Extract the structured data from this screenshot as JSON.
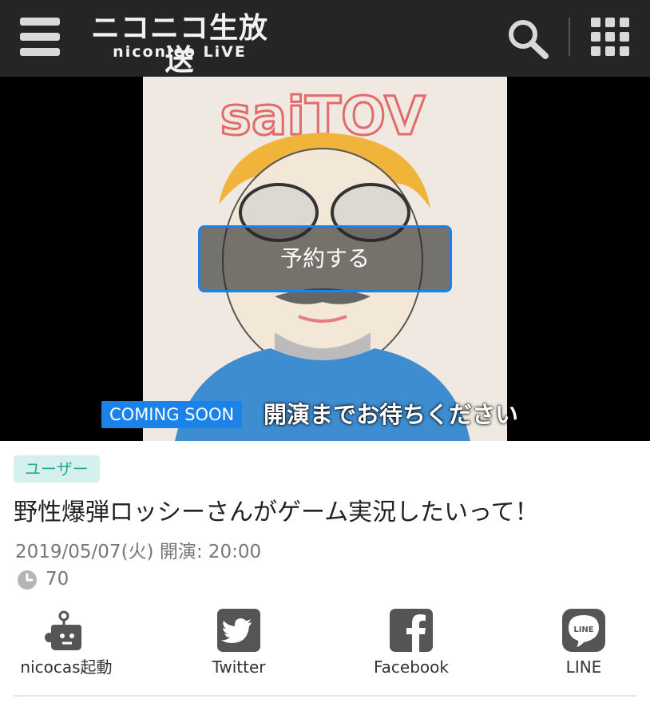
{
  "header": {
    "logo_main": "ニコニコ生放送",
    "logo_sub": "niconico LiVE",
    "icons": [
      "menu-icon",
      "search-icon",
      "grid-menu-icon"
    ]
  },
  "player": {
    "thumbnail_text": "saiTOV",
    "reserve_button": "予約する",
    "coming_soon_badge": "COMING SOON",
    "coming_soon_text": "開演までお待ちください"
  },
  "program": {
    "category": "ユーザー",
    "title": "野性爆弾ロッシーさんがゲーム実況したいって！",
    "datetime": "2019/05/07(火) 開演: 20:00",
    "viewer_count": "70"
  },
  "share": [
    {
      "label": "nicocas起動",
      "icon": "nicocas-icon"
    },
    {
      "label": "Twitter",
      "icon": "twitter-icon"
    },
    {
      "label": "Facebook",
      "icon": "facebook-icon"
    },
    {
      "label": "LINE",
      "icon": "line-icon"
    }
  ],
  "colors": {
    "header_bg": "#252525",
    "accent_blue": "#1a82e8",
    "category_bg": "#d4f1ee",
    "category_text": "#27a69a",
    "share_icon": "#555555"
  }
}
